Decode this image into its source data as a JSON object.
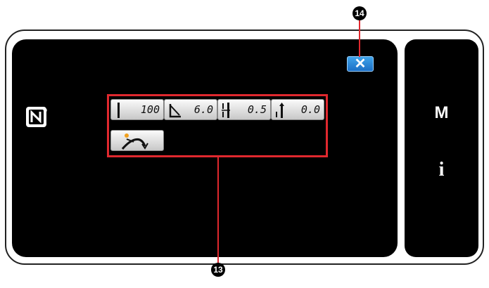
{
  "close_button": {
    "symbol": "✕"
  },
  "side_panel": {
    "mode_label": "M",
    "info_label": "i"
  },
  "params": [
    {
      "icon": "stitch-count-icon",
      "value": "100"
    },
    {
      "icon": "stitch-length-icon",
      "value": "6.0"
    },
    {
      "icon": "width-compensation-icon",
      "value": "0.5"
    },
    {
      "icon": "length-compensation-icon",
      "value": "0.0"
    }
  ],
  "curve_button": {
    "icon": "curve-sewing-icon"
  },
  "callouts": {
    "close": "14",
    "params": "13"
  },
  "colors": {
    "screen_bg": "#000000",
    "close_button": "#2b86d8",
    "callout_line": "#e0282e",
    "key_face": "#e6e6e6"
  }
}
